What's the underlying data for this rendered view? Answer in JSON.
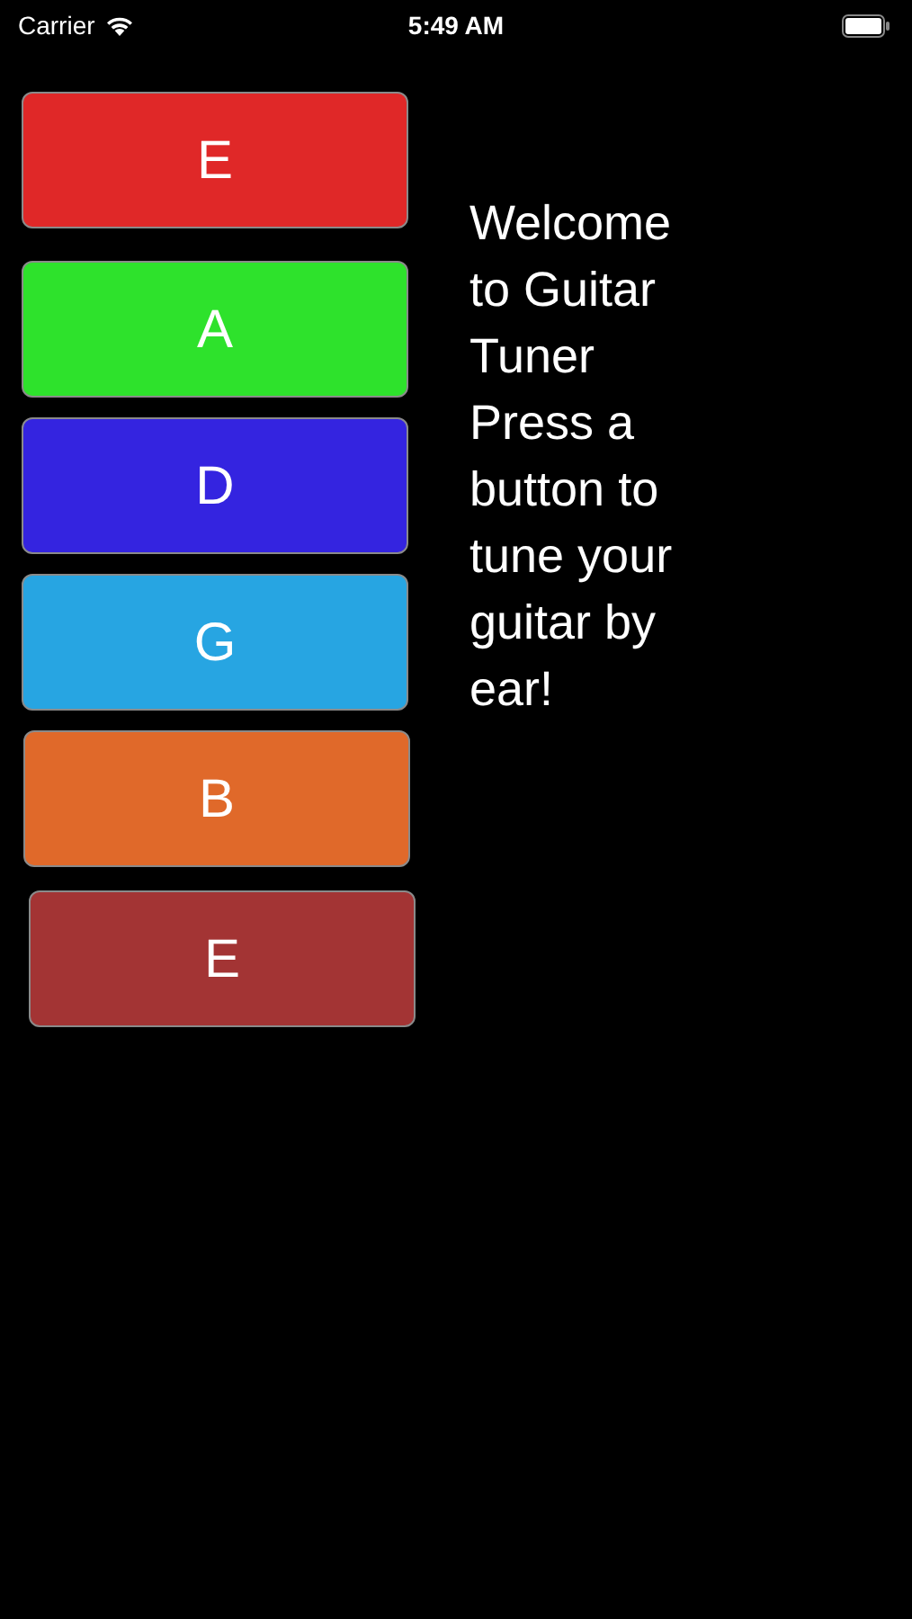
{
  "status_bar": {
    "carrier": "Carrier",
    "time": "5:49 AM"
  },
  "strings": [
    {
      "note": "E",
      "color": "#e02828"
    },
    {
      "note": "A",
      "color": "#2ee22c"
    },
    {
      "note": "D",
      "color": "#3424e0"
    },
    {
      "note": "G",
      "color": "#27a5e2"
    },
    {
      "note": "B",
      "color": "#e0692a"
    },
    {
      "note": "E",
      "color": "#a33434"
    }
  ],
  "message": [
    "Welcome to Guitar Tuner",
    "Press a button to tune your guitar by ear!"
  ]
}
